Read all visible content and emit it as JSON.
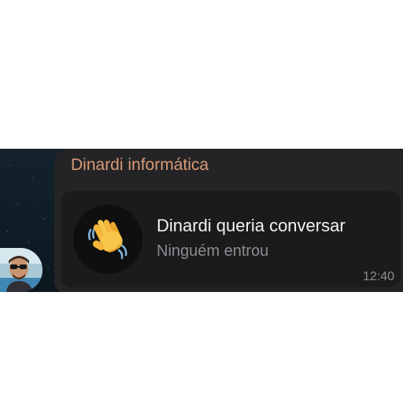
{
  "message": {
    "sender_name": "Dinardi informática",
    "call": {
      "icon": "waving-hand-icon",
      "title": "Dinardi queria conversar",
      "subtitle": "Ninguém entrou",
      "time": "12:40"
    }
  },
  "avatar": {
    "icon": "profile-photo"
  },
  "colors": {
    "sender_name": "#d99a75",
    "bubble": "#242426",
    "call_card": "#1b1b1d",
    "secondary_text": "#8c8c90"
  }
}
